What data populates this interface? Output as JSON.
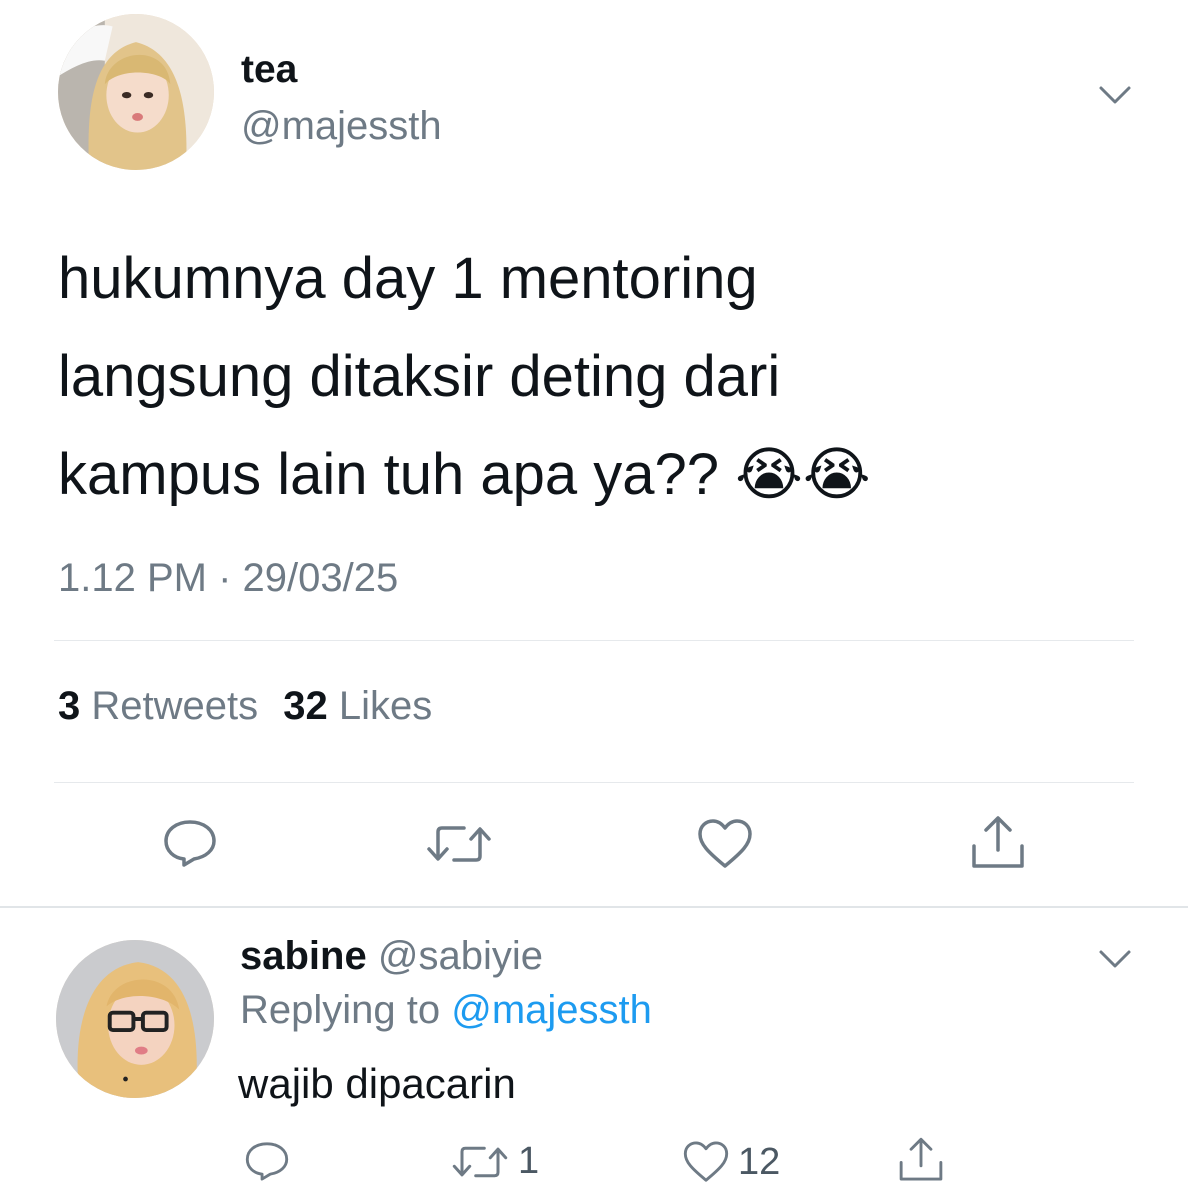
{
  "main_tweet": {
    "display_name": "tea",
    "handle": "@majessth",
    "text_lines": [
      "hukumnya day 1 mentoring",
      "langsung ditaksir deting dari",
      "kampus lain tuh apa ya?? 😭😭"
    ],
    "timestamp": "1.12 PM · 29/03/25",
    "retweets_count": "3",
    "retweets_label": "Retweets",
    "likes_count": "32",
    "likes_label": "Likes"
  },
  "reply": {
    "display_name": "sabine",
    "handle": "@sabiyie",
    "replying_prefix": "Replying to",
    "replying_to": "@majessth",
    "text": "wajib dipacarin",
    "reply_count": "",
    "retweet_count": "1",
    "like_count": "12"
  },
  "icons": {
    "menu": "chevron-down-icon",
    "reply": "reply-bubble-icon",
    "retweet": "retweet-icon",
    "like": "heart-icon",
    "share": "share-icon"
  },
  "colors": {
    "text": "#0f1419",
    "muted": "#6e7a85",
    "link": "#1d9bf0",
    "divider": "#e6e9ec"
  }
}
